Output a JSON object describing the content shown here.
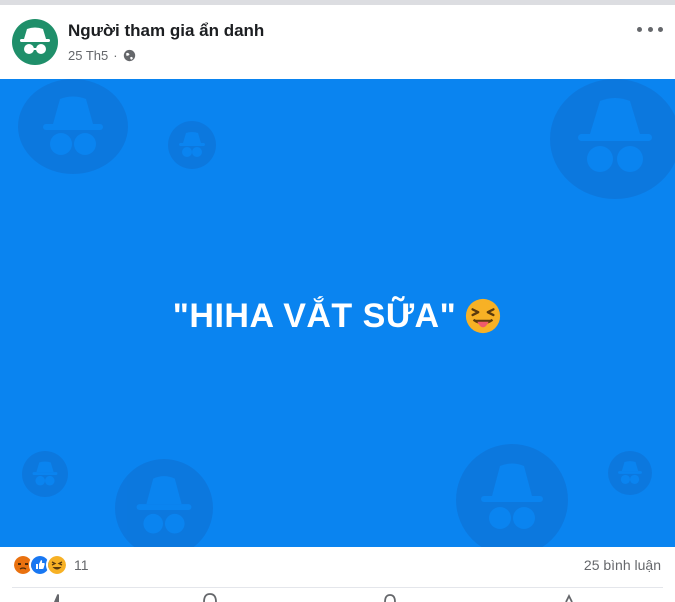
{
  "post": {
    "author": "Người tham gia ẩn danh",
    "date": "25 Th5",
    "separator": "·",
    "privacy_icon": "globe-icon",
    "avatar_icon": "incognito-icon",
    "more_icon": "more-options-icon",
    "text": "\"HIHA VẮT SỮA\"",
    "text_emoji": "squinting-tongue-face",
    "background_color": "#0a84f0"
  },
  "footer": {
    "reactions": [
      "angry",
      "like",
      "haha"
    ],
    "reaction_count": "11",
    "comments": "25 bình luận"
  },
  "colors": {
    "angry": "#e9710f",
    "like": "#1877f2",
    "haha": "#f7b125",
    "text_secondary": "#65676b"
  }
}
